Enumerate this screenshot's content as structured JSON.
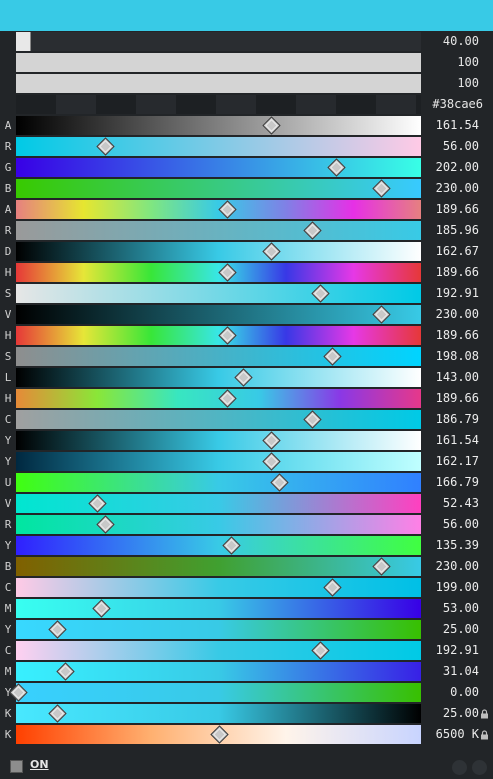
{
  "swatch_color": "#38cae6",
  "top": [
    {
      "value": "40.00",
      "fill_pct": 3.5
    },
    {
      "value": "100",
      "fill_pct": 100
    },
    {
      "value": "100",
      "fill_pct": 100
    }
  ],
  "hex": "#38cae6",
  "rows": [
    {
      "label": "A",
      "value": "161.54",
      "pos": 63,
      "bg": "linear-gradient(90deg,#000,#fff)"
    },
    {
      "label": "R",
      "value": "56.00",
      "pos": 22,
      "bg": "linear-gradient(90deg,#00cae6,#ffcae6)"
    },
    {
      "label": "G",
      "value": "202.00",
      "pos": 79,
      "bg": "linear-gradient(90deg,#3800e6,#38ffe6)"
    },
    {
      "label": "B",
      "value": "230.00",
      "pos": 90,
      "bg": "linear-gradient(90deg,#38ca00,#38caff)"
    },
    {
      "label": "A",
      "value": "189.66",
      "pos": 52,
      "bg": "linear-gradient(90deg,#e68080,#e6e630,#80e680,#38cae6,#8080e6,#e630e6,#e68080)"
    },
    {
      "label": "R",
      "value": "185.96",
      "pos": 73,
      "bg": "linear-gradient(90deg,#9a9a9a,#38cae6)"
    },
    {
      "label": "D",
      "value": "162.67",
      "pos": 63,
      "bg": "linear-gradient(90deg,#000,#38cae6,#fff)"
    },
    {
      "label": "H",
      "value": "189.66",
      "pos": 52,
      "bg": "linear-gradient(90deg,#e63838,#e6e638,#38e638,#38e6e6,#3838e6,#e638e6,#e63838)"
    },
    {
      "label": "S",
      "value": "192.91",
      "pos": 75,
      "bg": "linear-gradient(90deg,#e6e6e6,#00cae6)"
    },
    {
      "label": "V",
      "value": "230.00",
      "pos": 90,
      "bg": "linear-gradient(90deg,#000,#38cae6)"
    },
    {
      "label": "H",
      "value": "189.66",
      "pos": 52,
      "bg": "linear-gradient(90deg,#e63838,#e6e638,#38e638,#38e6e6,#3838e6,#e638e6,#e63838)"
    },
    {
      "label": "S",
      "value": "198.08",
      "pos": 78,
      "bg": "linear-gradient(90deg,#8e8e8e,#00d4ff)"
    },
    {
      "label": "L",
      "value": "143.00",
      "pos": 56,
      "bg": "linear-gradient(90deg,#000,#38cae6,#fff)"
    },
    {
      "label": "H",
      "value": "189.66",
      "pos": 52,
      "bg": "linear-gradient(90deg,#e68a38,#8ae638,#38e6c0,#38cae6,#8a38e6,#e6388a)"
    },
    {
      "label": "C",
      "value": "186.79",
      "pos": 73,
      "bg": "linear-gradient(90deg,#a0a0a0,#00cae6)"
    },
    {
      "label": "Y",
      "value": "161.54",
      "pos": 63,
      "bg": "linear-gradient(90deg,#000,#38cae6,#fff)"
    },
    {
      "label": "Y",
      "value": "162.17",
      "pos": 63,
      "bg": "linear-gradient(90deg,#002840,#38cae6,#c0ffff)"
    },
    {
      "label": "U",
      "value": "166.79",
      "pos": 65,
      "bg": "linear-gradient(90deg,#40ff10,#38cae6,#3080ff)"
    },
    {
      "label": "V",
      "value": "52.43",
      "pos": 20,
      "bg": "linear-gradient(90deg,#00e6d0,#38cae6,#ff40c0)"
    },
    {
      "label": "R",
      "value": "56.00",
      "pos": 22,
      "bg": "linear-gradient(90deg,#00e6a0,#38cae6,#ff80e6)"
    },
    {
      "label": "Y",
      "value": "135.39",
      "pos": 53,
      "bg": "linear-gradient(90deg,#3020ff,#38cae6,#40ff40)"
    },
    {
      "label": "B",
      "value": "230.00",
      "pos": 90,
      "bg": "linear-gradient(90deg,#806000,#40a030,#38cae6)"
    },
    {
      "label": "C",
      "value": "199.00",
      "pos": 78,
      "bg": "linear-gradient(90deg,#ffcae6,#38cae6,#00c0e6)"
    },
    {
      "label": "M",
      "value": "53.00",
      "pos": 21,
      "bg": "linear-gradient(90deg,#38fff0,#38cae6,#3800e6)"
    },
    {
      "label": "Y",
      "value": "25.00",
      "pos": 10,
      "bg": "linear-gradient(90deg,#38d8ff,#38cae6,#38c000)"
    },
    {
      "label": "C",
      "value": "192.91",
      "pos": 75,
      "bg": "linear-gradient(90deg,#ffd0f0,#38cae6,#00cae6)"
    },
    {
      "label": "M",
      "value": "31.04",
      "pos": 12,
      "bg": "linear-gradient(90deg,#38f0ff,#38cae6,#3820e6)"
    },
    {
      "label": "Y",
      "value": "0.00",
      "pos": 0.5,
      "bg": "linear-gradient(90deg,#38d0ff,#38cae6,#38c000)"
    },
    {
      "label": "K",
      "value": "25.00",
      "pos": 10,
      "bg": "linear-gradient(90deg,#48e8ff,#38cae6,#000)",
      "locked": true
    },
    {
      "label": "K",
      "value": "6500 K",
      "pos": 50,
      "bg": "linear-gradient(90deg,#ff4000,#ffb070,#fff4ea,#c8d4ff)",
      "locked": true
    }
  ],
  "footer": {
    "toggle_label": "ON"
  }
}
